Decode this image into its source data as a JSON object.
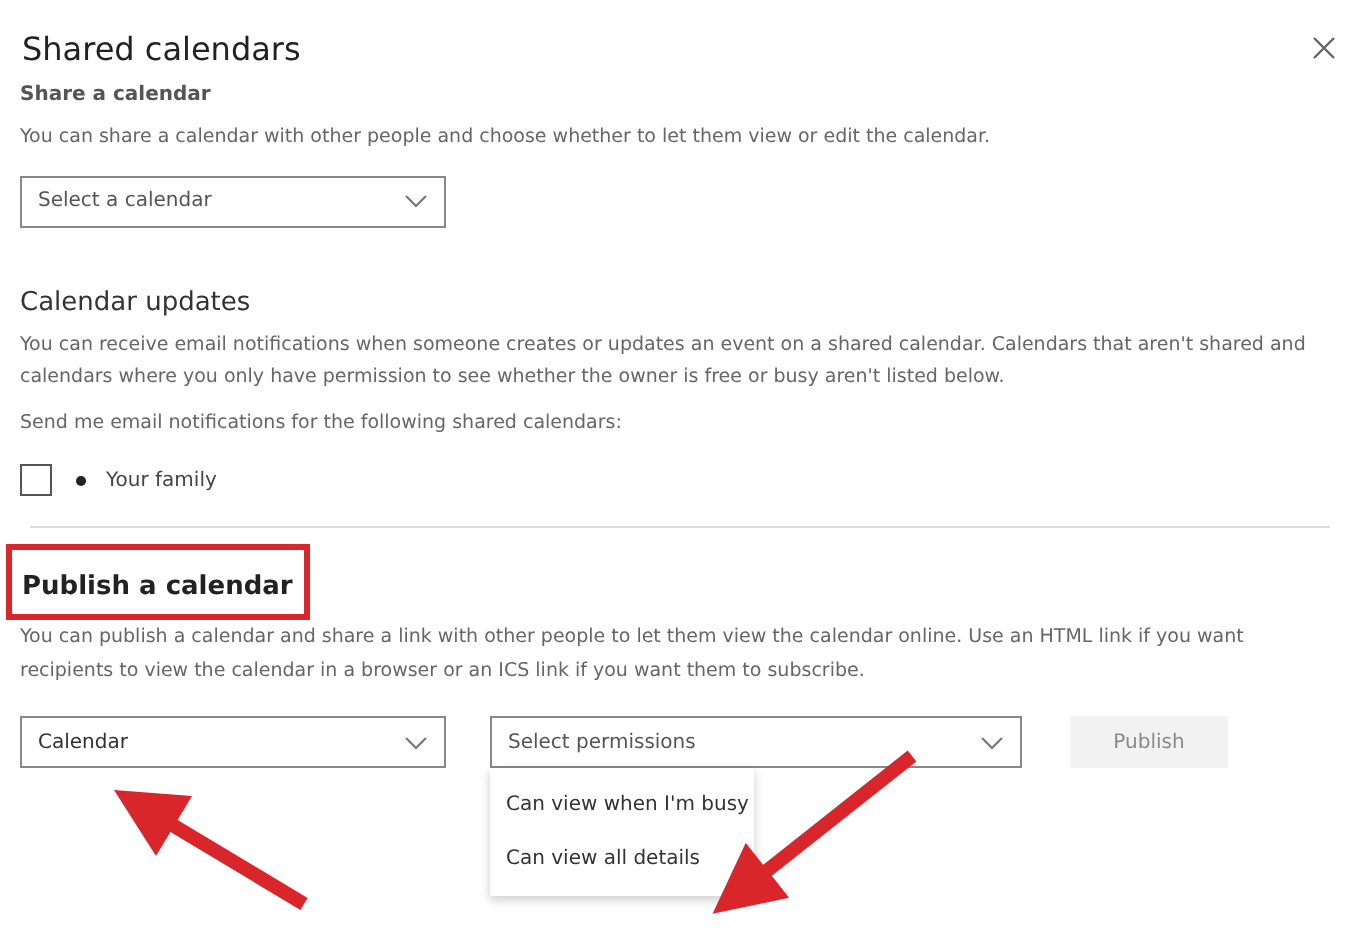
{
  "window": {
    "title": "Shared calendars"
  },
  "share": {
    "heading": "Share a calendar",
    "description": "You can share a calendar with other people and choose whether to let them view or edit the calendar.",
    "dropdown": {
      "placeholder": "Select a calendar"
    }
  },
  "updates": {
    "heading": "Calendar updates",
    "description": "You can receive email notifications when someone creates or updates an event on a shared calendar. Calendars that aren't shared and calendars where you only have permission to see whether the owner is free or busy aren't listed below.",
    "prompt": "Send me email notifications for the following shared calendars:",
    "calendars": [
      {
        "name": "Your family",
        "checked": false,
        "color": "#222222"
      }
    ]
  },
  "publish": {
    "heading": "Publish a calendar",
    "highlighted": true,
    "description": "You can publish a calendar and share a link with other people to let them view the calendar online. Use an HTML link if you want recipients to view the calendar in a browser or an ICS link if you want them to subscribe.",
    "calendar_dropdown": {
      "value": "Calendar"
    },
    "permissions_dropdown": {
      "placeholder": "Select permissions",
      "expanded": true,
      "options": [
        {
          "label": "Can view when I'm busy"
        },
        {
          "label": "Can view all details"
        }
      ]
    },
    "button": {
      "label": "Publish",
      "disabled": true
    }
  }
}
